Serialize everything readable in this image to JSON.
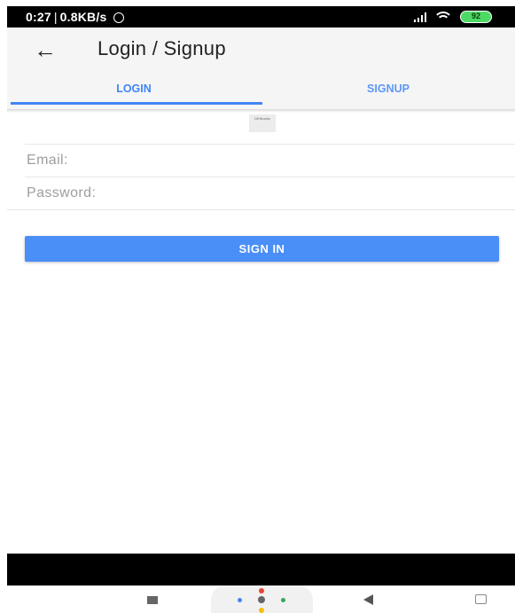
{
  "status_bar": {
    "time": "0:27",
    "separator": "|",
    "speed": "0.8KB/s",
    "battery": "92",
    "icons": [
      "alarm-icon",
      "signal-icon",
      "wifi-icon",
      "battery-icon"
    ]
  },
  "app_bar": {
    "back_icon": "arrow-left",
    "title": "Login / Signup"
  },
  "tabs": [
    {
      "label": "LOGIN",
      "active": true
    },
    {
      "label": "SIGNUP",
      "active": false
    }
  ],
  "logo": {
    "text": "DIHbooks"
  },
  "form": {
    "email_label": "Email:",
    "password_label": "Password:",
    "submit_label": "SIGN IN"
  },
  "colors": {
    "accent": "#4285f4",
    "button": "#4a8ef7",
    "app_bar_bg": "#f5f5f5",
    "battery": "#4cd964"
  },
  "nav_bar": {
    "icons": [
      "recent-apps-icon",
      "assistant-icon",
      "back-icon",
      "rotate-icon"
    ]
  }
}
